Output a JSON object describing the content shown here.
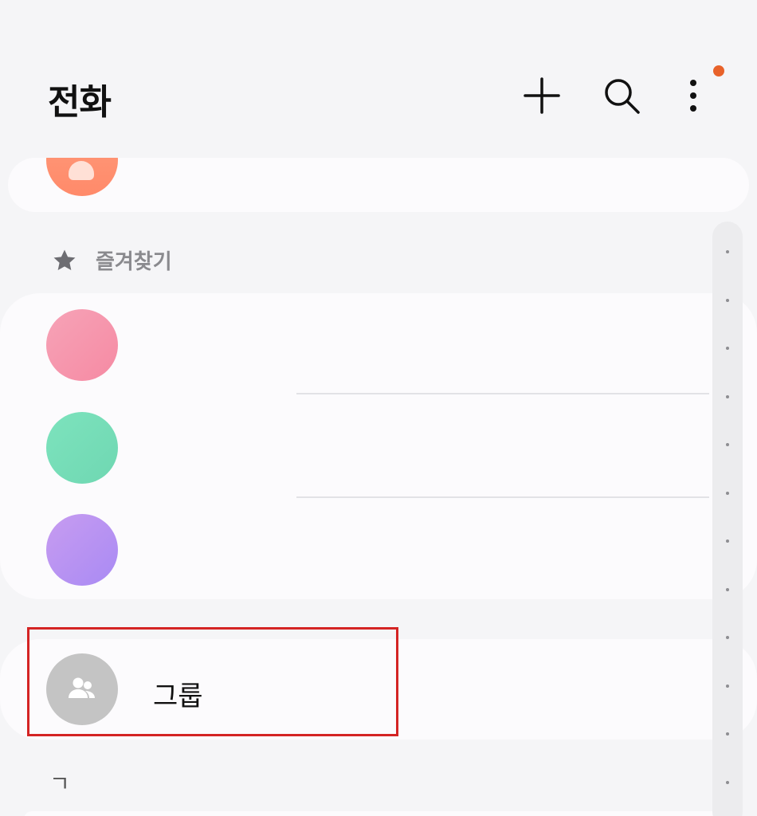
{
  "header": {
    "title": "전화",
    "add_icon": "plus-icon",
    "search_icon": "search-icon",
    "more_icon": "more-vertical-icon",
    "notification_dot_color": "#e8622a"
  },
  "favorites": {
    "section_label": "즐겨찾기",
    "section_icon": "star-icon",
    "contacts": [
      {
        "avatar_color": "#f7a3b7"
      },
      {
        "avatar_color": "#7de3bd"
      },
      {
        "avatar_color": "#b596f2"
      }
    ]
  },
  "groups": {
    "label": "그룹",
    "icon": "group-people-icon"
  },
  "index": {
    "label": "ㄱ"
  },
  "colors": {
    "highlight_border": "#d42424",
    "background": "#f5f5f7",
    "card": "#fcfbfd"
  }
}
